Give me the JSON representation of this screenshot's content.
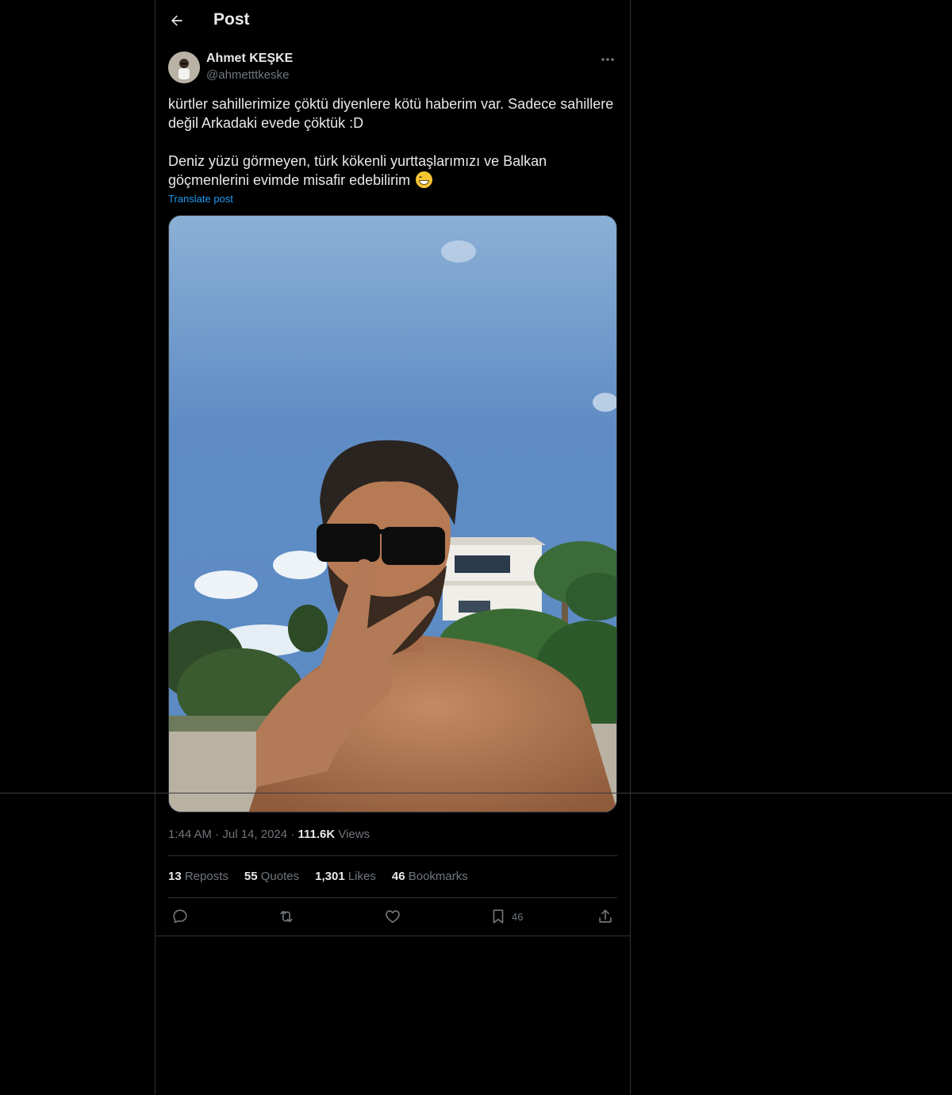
{
  "header": {
    "title": "Post",
    "back_icon": "arrow-left-icon"
  },
  "author": {
    "name": "Ahmet KEŞKE",
    "handle": "@ahmetttkeske",
    "more_icon": "more-horizontal-icon"
  },
  "post": {
    "paragraph1_line1": "kürtler sahillerimize çöktü diyenlere kötü haberim var. Sadece sahillere",
    "paragraph1_line2": "değil Arkadaki evede çöktük :D",
    "paragraph2_line1": "Deniz yüzü görmeyen, türk kökenli yurttaşlarımızı ve Balkan",
    "paragraph2_line2": "göçmenlerini evimde misafir edebilirim",
    "emoji": "grinning-face-emoji",
    "translate_label": "Translate post"
  },
  "meta": {
    "time": "1:44 AM",
    "separator": "·",
    "date": "Jul 14, 2024",
    "views_count": "111.6K",
    "views_label": "Views"
  },
  "stats": {
    "reposts_count": "13",
    "reposts_label": "Reposts",
    "quotes_count": "55",
    "quotes_label": "Quotes",
    "likes_count": "1,301",
    "likes_label": "Likes",
    "bookmarks_count": "46",
    "bookmarks_label": "Bookmarks"
  },
  "actions": {
    "reply_icon": "reply-icon",
    "repost_icon": "repost-icon",
    "like_icon": "heart-icon",
    "bookmark_icon": "bookmark-icon",
    "bookmark_count": "46",
    "share_icon": "share-icon"
  },
  "colors": {
    "background": "#000000",
    "text": "#e7e9ea",
    "muted": "#71767b",
    "accent": "#1d9bf0",
    "border": "#2f3336"
  }
}
